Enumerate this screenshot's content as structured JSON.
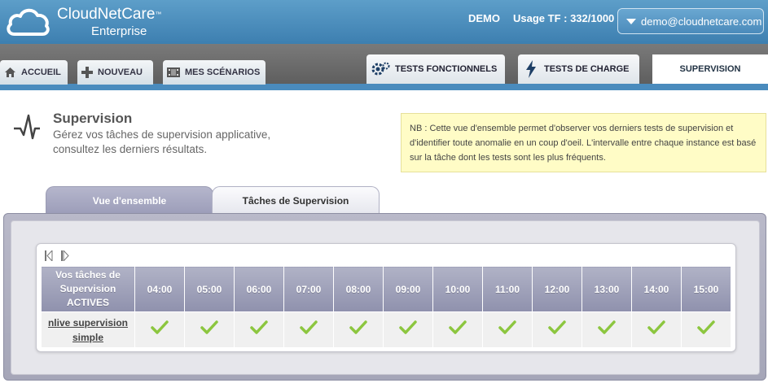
{
  "header": {
    "brand": "CloudNetCare",
    "brand_mark": "™",
    "brand_sub": "Enterprise",
    "account": "DEMO",
    "usage": "Usage TF : 332/1000",
    "user_email": "demo@cloudnetcare.com"
  },
  "nav": {
    "left_tabs": [
      {
        "label": "ACCUEIL",
        "icon": "home-icon"
      },
      {
        "label": "NOUVEAU",
        "icon": "plus-icon"
      },
      {
        "label": "MES SCÉNARIOS",
        "icon": "film-icon"
      }
    ],
    "right_tabs": [
      {
        "label": "TESTS FONCTIONNELS",
        "icon": "gears-icon"
      },
      {
        "label": "TESTS DE CHARGE",
        "icon": "lightning-icon"
      }
    ],
    "active_tab": "SUPERVISION"
  },
  "page": {
    "title": "Supervision",
    "description": "Gérez vos tâches de supervision applicative, consultez les derniers résultats.",
    "note": "NB : Cette vue d'ensemble permet d'observer vos derniers tests de supervision et d'identifier toute anomalie en un coup d'oeil. L'intervalle entre chaque instance est basé sur la tâche dont les tests sont les plus fréquents."
  },
  "subtabs": {
    "overview": "Vue d'ensemble",
    "tasks": "Tâches de Supervision"
  },
  "grid": {
    "header_first": "Vos tâches de Supervision ACTIVES",
    "times": [
      "04:00",
      "05:00",
      "06:00",
      "07:00",
      "08:00",
      "09:00",
      "10:00",
      "11:00",
      "12:00",
      "13:00",
      "14:00",
      "15:00"
    ],
    "rows": [
      {
        "name": "nlive supervision simple",
        "status": [
          "ok",
          "ok",
          "ok",
          "ok",
          "ok",
          "ok",
          "ok",
          "ok",
          "ok",
          "ok",
          "ok",
          "ok"
        ]
      }
    ],
    "check_color": "#8cc63f"
  }
}
